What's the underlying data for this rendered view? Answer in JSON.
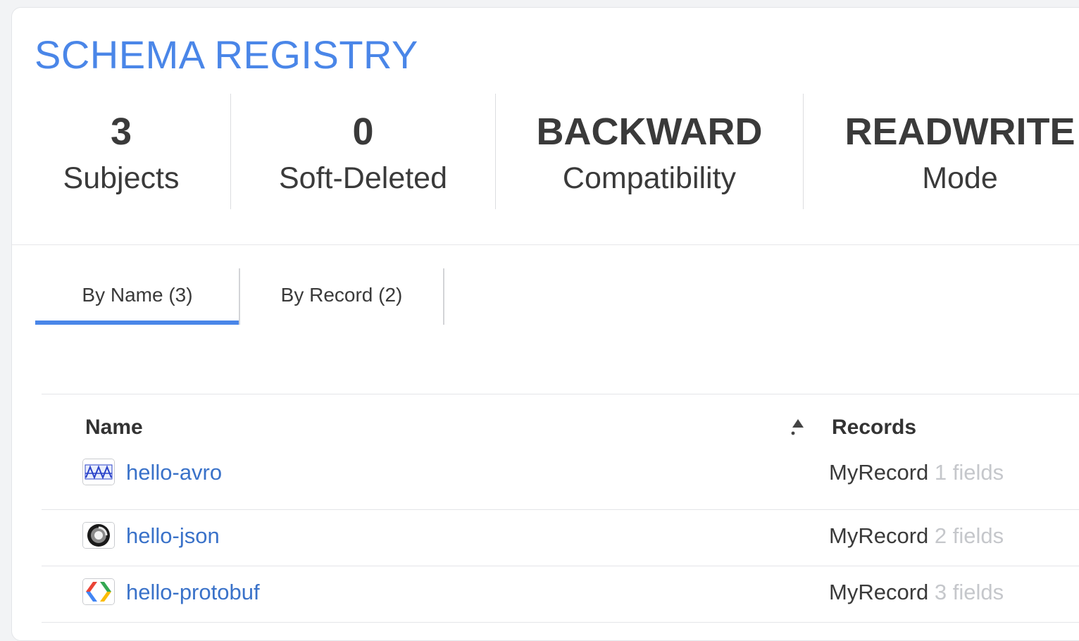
{
  "page": {
    "title": "SCHEMA REGISTRY"
  },
  "stats": [
    {
      "value": "3",
      "label": "Subjects"
    },
    {
      "value": "0",
      "label": "Soft-Deleted"
    },
    {
      "value": "BACKWARD",
      "label": "Compatibility"
    },
    {
      "value": "READWRITE",
      "label": "Mode"
    }
  ],
  "tabs": [
    {
      "label": "By Name (3)",
      "active": true
    },
    {
      "label": "By Record (2)",
      "active": false
    }
  ],
  "table": {
    "columns": {
      "name": "Name",
      "records": "Records"
    },
    "sort": {
      "column": "Name",
      "direction": "ascending",
      "icon": "sort-up-icon"
    },
    "rows": [
      {
        "name": "hello-avro",
        "type_icon": "avro-logo-icon",
        "record": "MyRecord",
        "field_count": "1",
        "fields_label": "fields"
      },
      {
        "name": "hello-json",
        "type_icon": "json-logo-icon",
        "record": "MyRecord",
        "field_count": "2",
        "fields_label": "fields"
      },
      {
        "name": "hello-protobuf",
        "type_icon": "protobuf-logo-icon",
        "record": "MyRecord",
        "field_count": "3",
        "fields_label": "fields"
      }
    ]
  },
  "colors": {
    "accent": "#4a86e8",
    "link": "#3a72c9",
    "text": "#3a3a3a",
    "muted": "#c5c7cb"
  }
}
